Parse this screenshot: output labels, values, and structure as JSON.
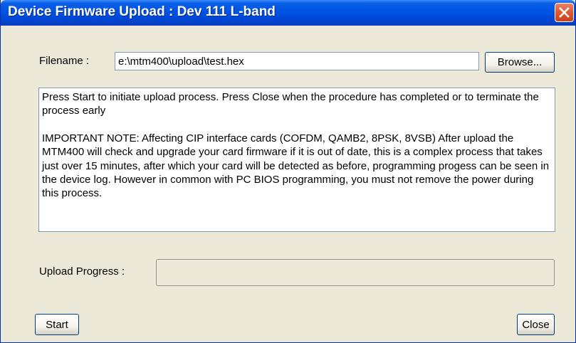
{
  "window": {
    "title": "Device Firmware Upload : Dev 111 L-band",
    "close_icon": "close-icon"
  },
  "form": {
    "filename_label": "Filename :",
    "filename_value": "e:\\mtm400\\upload\\test.hex",
    "browse_label": "Browse...",
    "info_paragraphs": [
      "Press Start to initiate upload process. Press Close when the procedure has completed or to terminate the process early",
      "IMPORTANT NOTE: Affecting CIP interface cards (COFDM, QAMB2, 8PSK, 8VSB) After upload the MTM400 will check and upgrade your card firmware if it is out of date, this is a complex process that takes just over 15 minutes, after which your card will be detected as before, programming progess can be seen in the device log. However in common with PC BIOS programming, you must not remove the power during this process."
    ],
    "progress_label": "Upload Progress :",
    "progress_fraction": 0
  },
  "buttons": {
    "start_label": "Start",
    "close_label": "Close"
  },
  "colors": {
    "titlebar": "#0054e3",
    "dialog_background": "#ece9d8",
    "close_button": "#e25b33"
  }
}
